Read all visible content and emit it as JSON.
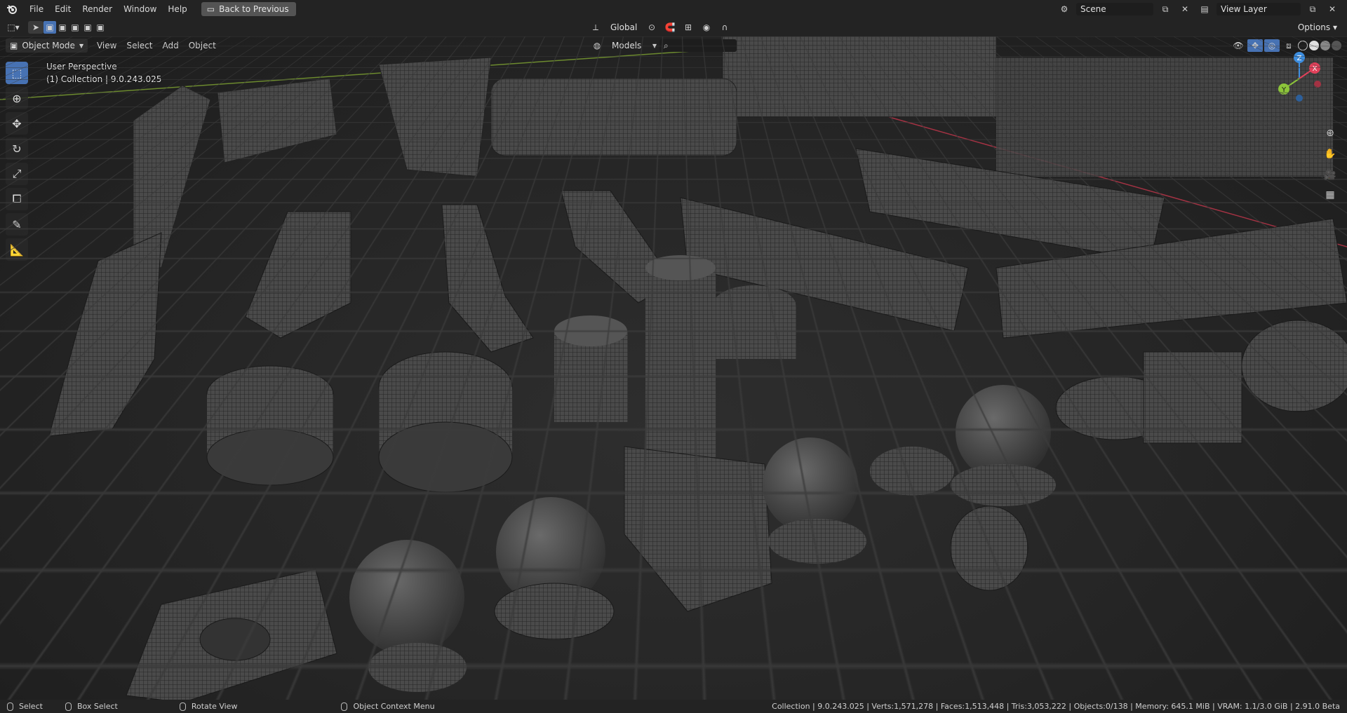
{
  "menu": {
    "items": [
      "File",
      "Edit",
      "Render",
      "Window",
      "Help"
    ],
    "back_label": "Back to Previous"
  },
  "scene": {
    "label": "Scene",
    "view_layer": "View Layer"
  },
  "header": {
    "mode": "Object Mode",
    "menus": [
      "View",
      "Select",
      "Add",
      "Object"
    ],
    "transform_orientation": "Global",
    "collection_filter": "Models",
    "options_label": "Options"
  },
  "viewport": {
    "perspective": "User Perspective",
    "collection_line": "(1) Collection | 9.0.243.025"
  },
  "gizmo": {
    "x": "X",
    "y": "Y",
    "z": "Z"
  },
  "status": {
    "select": "Select",
    "box_select": "Box Select",
    "rotate_view": "Rotate View",
    "context_menu": "Object Context Menu",
    "stats": "Collection | 9.0.243.025 | Verts:1,571,278 | Faces:1,513,448 | Tris:3,053,222 | Objects:0/138 | Memory: 645.1 MiB | VRAM: 1.1/3.0 GiB | 2.91.0 Beta"
  },
  "colors": {
    "accent": "#4772b3",
    "axis_x": "#e0415a",
    "axis_y": "#8cc43a",
    "axis_z": "#3d8ee0"
  },
  "tools": [
    "select-box-icon",
    "cursor-icon",
    "move-icon",
    "rotate-icon",
    "scale-icon",
    "transform-icon",
    "annotate-icon",
    "measure-icon"
  ]
}
